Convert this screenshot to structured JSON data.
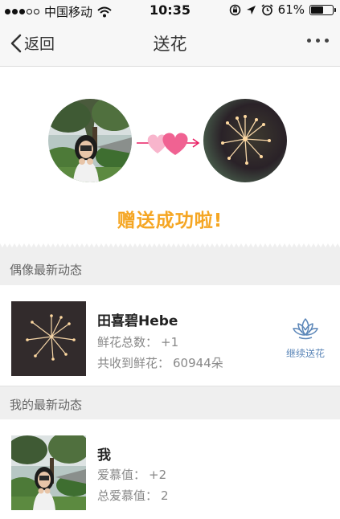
{
  "status_bar": {
    "carrier": "中国移动",
    "time": "10:35",
    "battery_pct": "61%",
    "battery_level": 0.61,
    "signal_filled": 3,
    "signal_total": 5,
    "icons": [
      "wifi-icon",
      "rotation-lock-icon",
      "location-arrow-icon",
      "alarm-icon",
      "battery-icon"
    ]
  },
  "nav": {
    "back_label": "返回",
    "title": "送花",
    "more_icon": "more-dots-icon"
  },
  "hero": {
    "message": "赠送成功啦!",
    "message_color": "#f5a623",
    "heart_color": "#f06292",
    "arrow_color": "#e91e63"
  },
  "idol_section": {
    "header": "偶像最新动态",
    "name": "田喜碧Hebe",
    "flowers_label": "鲜花总数：",
    "flowers_value": "+1",
    "received_label": "共收到鲜花：",
    "received_value": "60944朵",
    "action_label": "继续送花",
    "action_icon": "lotus-flower-icon",
    "action_color": "#5b86b8"
  },
  "my_section": {
    "header": "我的最新动态",
    "name": "我",
    "love_label": "爱慕值：",
    "love_value": "+2",
    "total_love_label": "总爱慕值：",
    "total_love_value": "2"
  }
}
